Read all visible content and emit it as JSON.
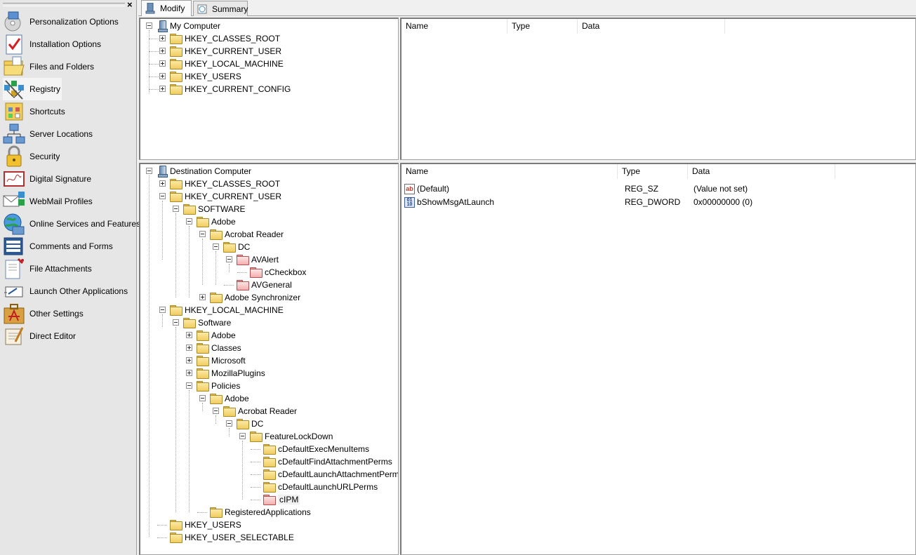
{
  "sidebar": {
    "close_glyph": "×",
    "items": [
      {
        "label": "Personalization Options",
        "icon": "personalization-icon"
      },
      {
        "label": "Installation Options",
        "icon": "checklist-icon"
      },
      {
        "label": "Files and Folders",
        "icon": "folder-icon"
      },
      {
        "label": "Registry",
        "icon": "registry-icon"
      },
      {
        "label": "Shortcuts",
        "icon": "shortcuts-icon"
      },
      {
        "label": "Server Locations",
        "icon": "network-icon"
      },
      {
        "label": "Security",
        "icon": "lock-icon"
      },
      {
        "label": "Digital Signature",
        "icon": "signature-icon"
      },
      {
        "label": "WebMail Profiles",
        "icon": "envelope-icon"
      },
      {
        "label": "Online Services and Features",
        "icon": "globe-icon"
      },
      {
        "label": "Comments and Forms",
        "icon": "forms-icon"
      },
      {
        "label": "File Attachments",
        "icon": "attachment-icon"
      },
      {
        "label": "Launch Other Applications",
        "icon": "launch-icon"
      },
      {
        "label": "Other Settings",
        "icon": "acrobat-icon"
      },
      {
        "label": "Direct Editor",
        "icon": "editor-icon"
      }
    ],
    "active_index": 3
  },
  "tabs": [
    {
      "label": "Modify",
      "active": true
    },
    {
      "label": "Summary",
      "active": false
    }
  ],
  "source_tree": {
    "root": "My Computer",
    "children": [
      "HKEY_CLASSES_ROOT",
      "HKEY_CURRENT_USER",
      "HKEY_LOCAL_MACHINE",
      "HKEY_USERS",
      "HKEY_CURRENT_CONFIG"
    ]
  },
  "source_list": {
    "columns": [
      "Name",
      "Type",
      "Data"
    ]
  },
  "dest_tree": {
    "root": "Destination Computer",
    "nodes": [
      {
        "label": "HKEY_CLASSES_ROOT"
      },
      {
        "label": "HKEY_CURRENT_USER"
      },
      {
        "label": "SOFTWARE"
      },
      {
        "label": "Adobe"
      },
      {
        "label": "Acrobat Reader"
      },
      {
        "label": "DC"
      },
      {
        "label": "AVAlert"
      },
      {
        "label": "cCheckbox"
      },
      {
        "label": "AVGeneral"
      },
      {
        "label": "Adobe Synchronizer"
      },
      {
        "label": "HKEY_LOCAL_MACHINE"
      },
      {
        "label": "Software"
      },
      {
        "label": "Adobe"
      },
      {
        "label": "Classes"
      },
      {
        "label": "Microsoft"
      },
      {
        "label": "MozillaPlugins"
      },
      {
        "label": "Policies"
      },
      {
        "label": "Adobe"
      },
      {
        "label": "Acrobat Reader"
      },
      {
        "label": "DC"
      },
      {
        "label": "FeatureLockDown"
      },
      {
        "label": "cDefaultExecMenuItems"
      },
      {
        "label": "cDefaultFindAttachmentPerms"
      },
      {
        "label": "cDefaultLaunchAttachmentPerm"
      },
      {
        "label": "cDefaultLaunchURLPerms"
      },
      {
        "label": "cIPM"
      },
      {
        "label": "RegisteredApplications"
      },
      {
        "label": "HKEY_USERS"
      },
      {
        "label": "HKEY_USER_SELECTABLE"
      }
    ]
  },
  "dest_list": {
    "columns": [
      "Name",
      "Type",
      "Data"
    ],
    "rows": [
      {
        "name": "(Default)",
        "type": "REG_SZ",
        "data": "(Value not set)",
        "icon": "ab"
      },
      {
        "name": "bShowMsgAtLaunch",
        "type": "REG_DWORD",
        "data": "0x00000000 (0)",
        "icon": "010"
      }
    ]
  }
}
